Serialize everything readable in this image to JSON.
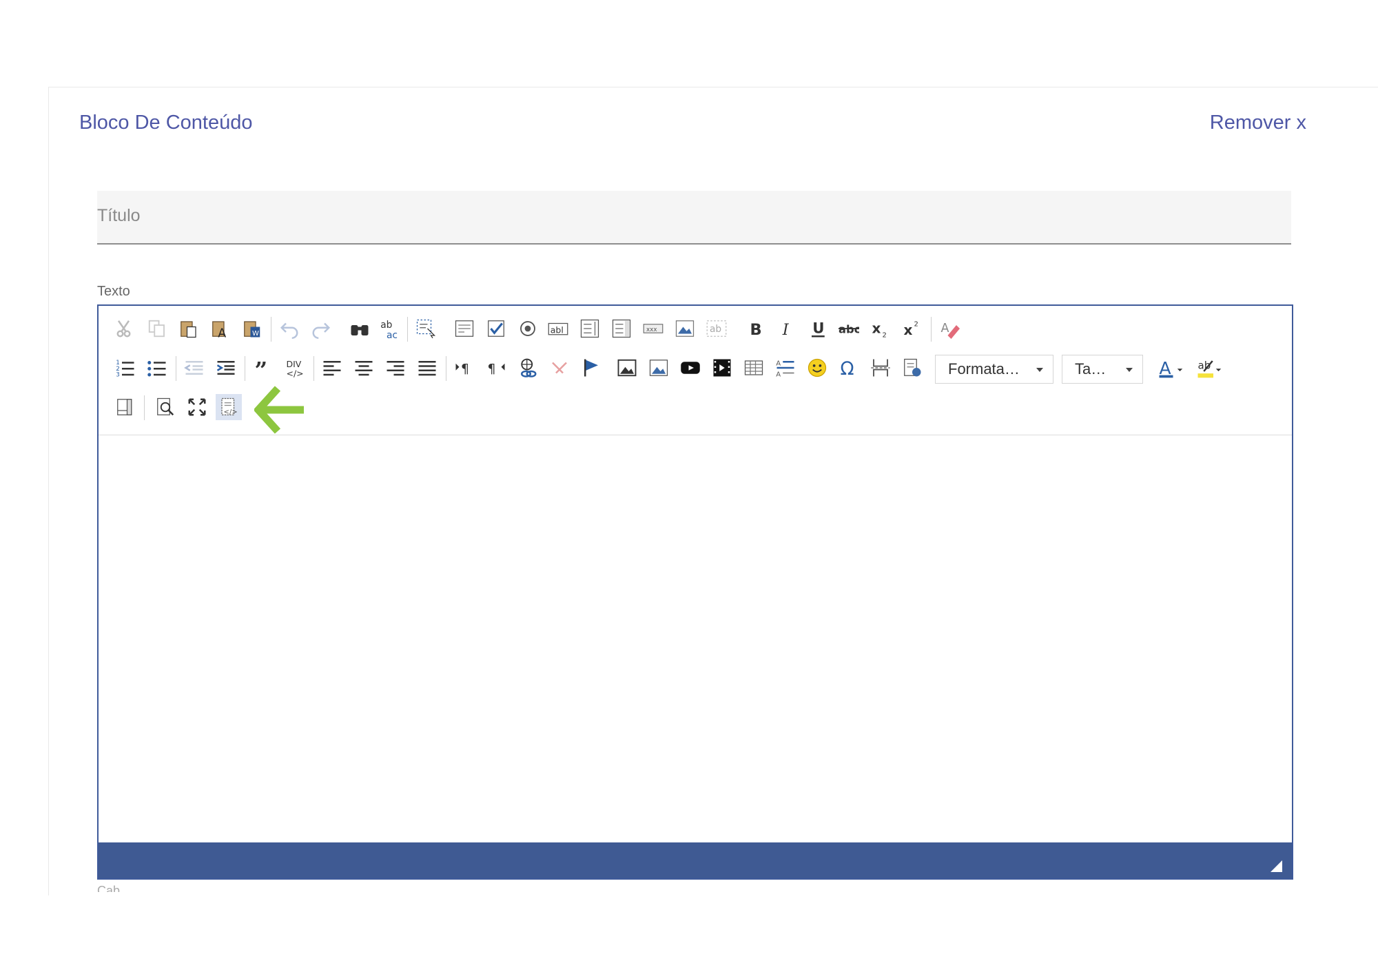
{
  "block": {
    "title": "Bloco De Conteúdo",
    "remove_label": "Remover x"
  },
  "title_field": {
    "placeholder": "Título"
  },
  "text_label": "Texto",
  "editor": {
    "format_combo": "Formata…",
    "size_combo": "Ta…",
    "toolbar_row1": [
      "cut-icon",
      "copy-icon",
      "paste-icon",
      "paste-text-icon",
      "paste-word-icon",
      "undo-icon",
      "redo-icon",
      "find-icon",
      "replace-icon",
      "select-all-icon",
      "form-icon",
      "checkbox-icon",
      "radio-icon",
      "text-field-icon",
      "textarea-icon",
      "select-icon",
      "button-icon",
      "image-button-icon",
      "hidden-field-icon",
      "bold-icon",
      "italic-icon",
      "underline-icon",
      "strike-icon",
      "subscript-icon",
      "superscript-icon",
      "remove-format-icon"
    ],
    "toolbar_row2": [
      "numbered-list-icon",
      "bulleted-list-icon",
      "outdent-icon",
      "indent-icon",
      "blockquote-icon",
      "div-icon",
      "align-left-icon",
      "align-center-icon",
      "align-right-icon",
      "justify-icon",
      "ltr-icon",
      "rtl-icon",
      "link-icon",
      "unlink-icon",
      "anchor-icon",
      "image-icon",
      "image2-icon",
      "youtube-icon",
      "video-icon",
      "table-icon",
      "horizontal-rule-icon",
      "smiley-icon",
      "special-char-icon",
      "page-break-icon",
      "iframe-icon",
      "text-color-icon",
      "bg-color-icon"
    ],
    "toolbar_row3": [
      "templates-icon",
      "preview-icon",
      "maximize-icon",
      "source-icon"
    ],
    "highlight_color": "#8dc63f",
    "accent_color": "#3f5a93"
  },
  "below_label": "Cab..."
}
